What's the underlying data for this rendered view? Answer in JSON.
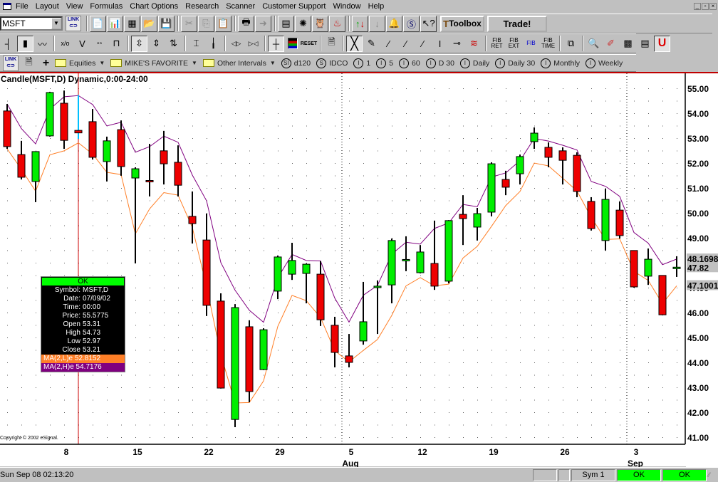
{
  "menu": [
    "File",
    "Layout",
    "View",
    "Formulas",
    "Chart Options",
    "Research",
    "Scanner",
    "Customer Support",
    "Window",
    "Help"
  ],
  "toolbar": {
    "symbol": "MSFT",
    "link_label": "LINK",
    "toolbox_label": "Toolbox",
    "trade_label": "Trade!",
    "reset_label": "RESET",
    "fib_ret": "FIB RET",
    "fib_ext": "FIB EXT",
    "fib_arc": "FIB",
    "fib_time": "FIB TIME"
  },
  "pages": {
    "folders": [
      "Equities",
      "MIKE'S FAVORITE",
      "Other Intervals"
    ],
    "intervals": [
      {
        "icon": "SI",
        "label": "d120"
      },
      {
        "icon": "S",
        "label": "IDCO"
      },
      {
        "icon": "I",
        "label": "1"
      },
      {
        "icon": "I",
        "label": "5"
      },
      {
        "icon": "I",
        "label": "60"
      },
      {
        "icon": "I",
        "label": "D 30"
      },
      {
        "icon": "I",
        "label": "Daily"
      },
      {
        "icon": "I",
        "label": "Daily 30"
      },
      {
        "icon": "I",
        "label": "Monthly"
      },
      {
        "icon": "I",
        "label": "Weekly"
      }
    ]
  },
  "chart_title": "Candle(MSFT,D) Dynamic,0:00-24:00",
  "copyright": "Copyright © 2002 eSignal.",
  "data_window": {
    "ok": "OK",
    "rows": [
      {
        "k": "Symbol:",
        "v": "MSFT,D"
      },
      {
        "k": "Date:",
        "v": "07/09/02"
      },
      {
        "k": "Time:",
        "v": "00:00"
      },
      {
        "k": "Price:",
        "v": "55.5775"
      },
      {
        "k": "Open",
        "v": "53.31"
      },
      {
        "k": "High",
        "v": "54.73"
      },
      {
        "k": "Low",
        "v": "52.97"
      },
      {
        "k": "Close",
        "v": "53.21"
      }
    ],
    "ma_low": "MA(2,L)e 52.8152",
    "ma_high": "MA(2,H)e 54.7176"
  },
  "colors": {
    "up": "#00ee00",
    "down": "#ee0000",
    "ma_low": "#ff7f27",
    "ma_high": "#800080",
    "cursor": "#cc0000"
  },
  "chart_data": {
    "type": "candlestick",
    "symbol": "MSFT",
    "interval": "D",
    "ylim": [
      41,
      55.3
    ],
    "y_ticks": [
      "55.00",
      "54.00",
      "53.00",
      "52.00",
      "51.00",
      "50.00",
      "49.00",
      "48.00",
      "47.00",
      "46.00",
      "45.00",
      "44.00",
      "43.00",
      "42.00",
      "41.00"
    ],
    "price_markers": [
      {
        "label": "48.1698",
        "value": 48.1698
      },
      {
        "label": "47.82",
        "value": 47.82
      },
      {
        "label": "47.1001",
        "value": 47.1001
      }
    ],
    "x_ticks": [
      {
        "label": "8",
        "index": 4
      },
      {
        "label": "15",
        "index": 9
      },
      {
        "label": "22",
        "index": 14
      },
      {
        "label": "29",
        "index": 19
      },
      {
        "label": "5",
        "index": 24
      },
      {
        "label": "12",
        "index": 29
      },
      {
        "label": "19",
        "index": 34
      },
      {
        "label": "26",
        "index": 39
      },
      {
        "label": "3",
        "index": 44
      }
    ],
    "months": [
      {
        "label": "Aug",
        "index": 23.5
      },
      {
        "label": "Sep",
        "index": 43.5
      }
    ],
    "cursor_index": 5,
    "series_names": [
      "MA(2,L)e",
      "MA(2,H)e"
    ],
    "ohlc": [
      [
        54.09,
        54.37,
        52.57,
        52.66
      ],
      [
        52.34,
        52.89,
        51.34,
        51.43
      ],
      [
        51.26,
        52.46,
        50.43,
        52.46
      ],
      [
        53.09,
        54.86,
        53.06,
        54.83
      ],
      [
        54.4,
        54.91,
        52.57,
        52.91
      ],
      [
        53.31,
        54.73,
        52.97,
        53.21
      ],
      [
        53.66,
        54.17,
        52.14,
        52.23
      ],
      [
        52.06,
        53.06,
        51.26,
        52.89
      ],
      [
        53.34,
        53.71,
        51.49,
        51.86
      ],
      [
        51.4,
        51.83,
        47.97,
        51.77
      ],
      [
        51.3,
        52.77,
        50.66,
        51.28
      ],
      [
        52.49,
        53.29,
        51.14,
        51.97
      ],
      [
        52.03,
        52.71,
        50.66,
        51.11
      ],
      [
        49.86,
        50.86,
        48.77,
        49.57
      ],
      [
        48.91,
        49.97,
        45.86,
        46.29
      ],
      [
        46.46,
        46.77,
        42.95,
        42.97
      ],
      [
        41.71,
        46.34,
        41.4,
        46.2
      ],
      [
        45.43,
        45.69,
        42.4,
        42.83
      ],
      [
        43.71,
        45.37,
        43.69,
        45.31
      ],
      [
        46.86,
        48.29,
        46.54,
        48.23
      ],
      [
        47.54,
        48.8,
        47.31,
        48.09
      ],
      [
        47.57,
        47.97,
        46.37,
        47.94
      ],
      [
        47.54,
        48.06,
        45.46,
        45.71
      ],
      [
        45.49,
        45.83,
        43.8,
        44.4
      ],
      [
        44.26,
        45.14,
        43.8,
        44.0
      ],
      [
        44.86,
        47.23,
        44.71,
        45.63
      ],
      [
        47.0,
        47.29,
        45.14,
        47.06
      ],
      [
        47.11,
        48.97,
        46.37,
        48.89
      ],
      [
        48.11,
        49.06,
        47.66,
        48.13
      ],
      [
        47.6,
        48.71,
        47.57,
        48.43
      ],
      [
        47.97,
        49.69,
        46.91,
        47.06
      ],
      [
        47.26,
        49.71,
        47.17,
        49.69
      ],
      [
        49.94,
        50.71,
        48.71,
        49.77
      ],
      [
        49.43,
        50.2,
        48.89,
        49.97
      ],
      [
        50.03,
        52.03,
        49.86,
        51.97
      ],
      [
        51.34,
        51.69,
        50.71,
        51.03
      ],
      [
        51.57,
        52.34,
        51.14,
        52.26
      ],
      [
        52.86,
        53.43,
        52.57,
        53.2
      ],
      [
        52.63,
        52.83,
        51.83,
        52.23
      ],
      [
        52.49,
        52.63,
        51.14,
        52.11
      ],
      [
        52.31,
        52.43,
        50.63,
        50.86
      ],
      [
        50.46,
        50.63,
        49.29,
        49.37
      ],
      [
        48.89,
        50.97,
        48.49,
        50.54
      ],
      [
        50.11,
        50.46,
        48.97,
        49.09
      ],
      [
        48.49,
        48.49,
        47.0,
        47.03
      ],
      [
        47.46,
        48.57,
        47.11,
        48.14
      ],
      [
        47.49,
        47.49,
        45.89,
        45.91
      ],
      [
        47.8,
        48.26,
        47.43,
        47.82
      ]
    ]
  },
  "status": {
    "time": "Sun Sep 08 02:13:20",
    "panels": [
      "",
      "",
      "Sym 1",
      "OK",
      "OK"
    ]
  }
}
